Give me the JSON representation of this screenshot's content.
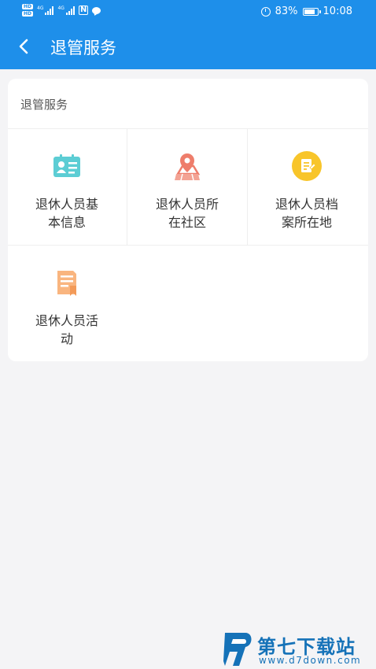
{
  "status_bar": {
    "hd1": "HD",
    "hd2": "HD",
    "net1": "4G",
    "net2": "4G",
    "nfc": "N",
    "battery": "83%",
    "time": "10:08"
  },
  "header": {
    "title": "退管服务",
    "back_icon": "chevron-left-icon",
    "color": "#1e8fea"
  },
  "section": {
    "title": "退管服务",
    "items": [
      {
        "label_line1": "退休人员基",
        "label_line2": "本信息",
        "icon": "id-card-icon",
        "color": "#5ccdd4"
      },
      {
        "label_line1": "退休人员所",
        "label_line2": "在社区",
        "icon": "map-pin-icon",
        "color": "#ee7d6b"
      },
      {
        "label_line1": "退休人员档",
        "label_line2": "案所在地",
        "icon": "archive-icon",
        "color": "#f8c52a"
      },
      {
        "label_line1": "退休人员活",
        "label_line2": "动",
        "icon": "activity-doc-icon",
        "color": "#f9b57f"
      }
    ]
  },
  "watermark": {
    "brand": "第七下载站",
    "url": "www.d7down.com",
    "color": "#1572b8"
  }
}
